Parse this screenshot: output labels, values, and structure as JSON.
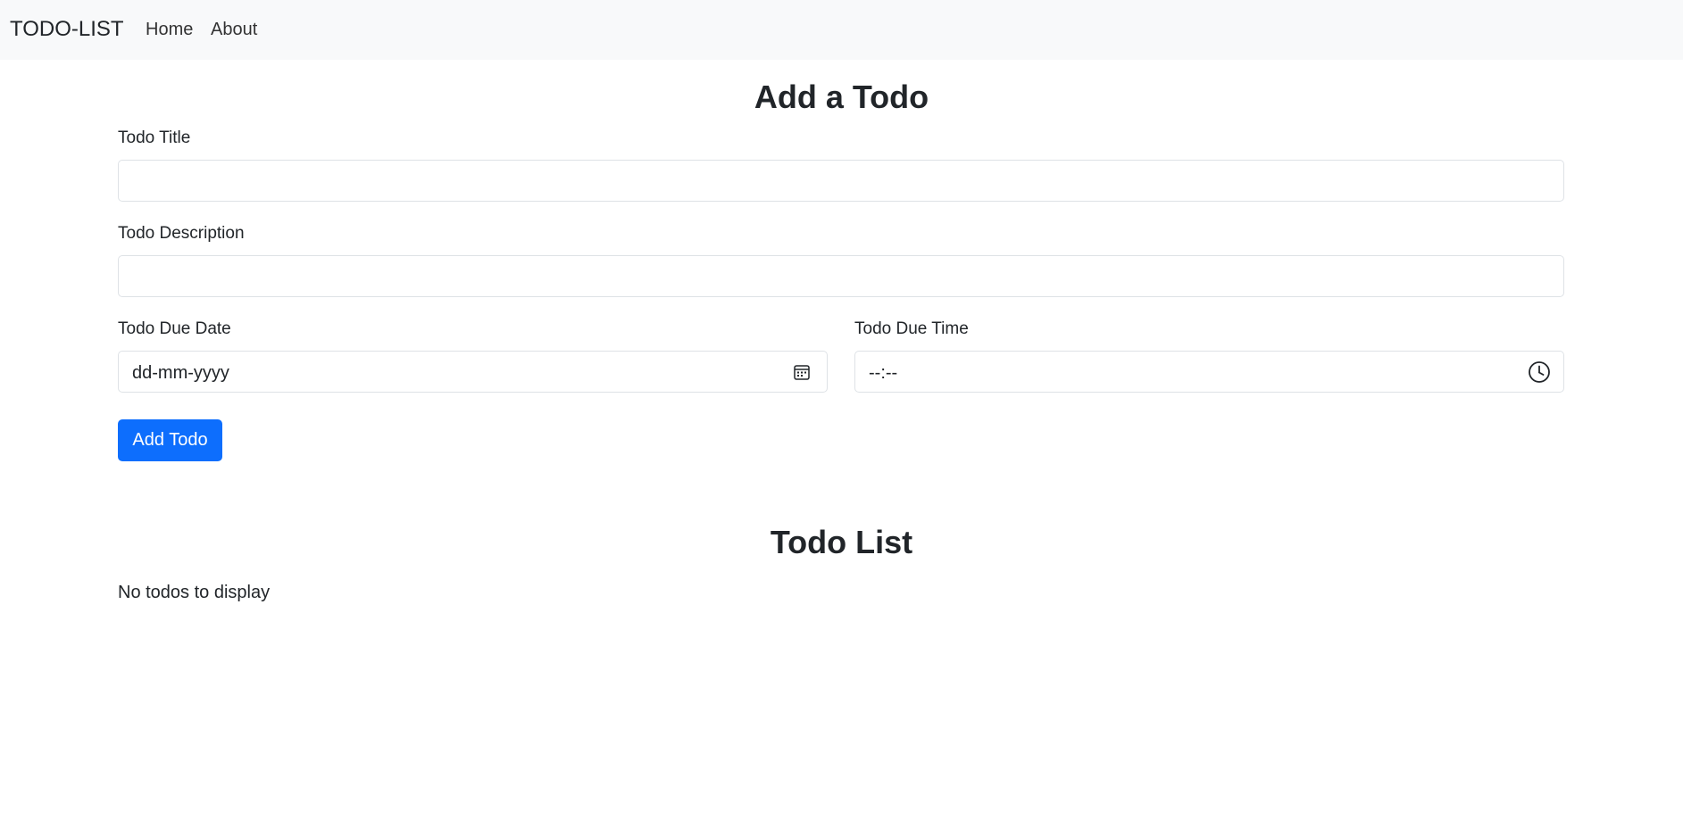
{
  "navbar": {
    "brand": "TODO-LIST",
    "links": [
      "Home",
      "About"
    ]
  },
  "form": {
    "heading": "Add a Todo",
    "title_label": "Todo Title",
    "title_value": "",
    "description_label": "Todo Description",
    "description_value": "",
    "date_label": "Todo Due Date",
    "date_placeholder": "dd-mm-yyyy",
    "time_label": "Todo Due Time",
    "time_placeholder": "--:--",
    "submit_label": "Add Todo"
  },
  "list": {
    "heading": "Todo List",
    "empty_message": "No todos to display"
  },
  "colors": {
    "navbar_bg": "#f8f9fa",
    "primary": "#0d6efd",
    "text": "#212529",
    "border": "#dee2e6"
  },
  "icons": {
    "date": "calendar-icon",
    "time": "clock-icon"
  }
}
